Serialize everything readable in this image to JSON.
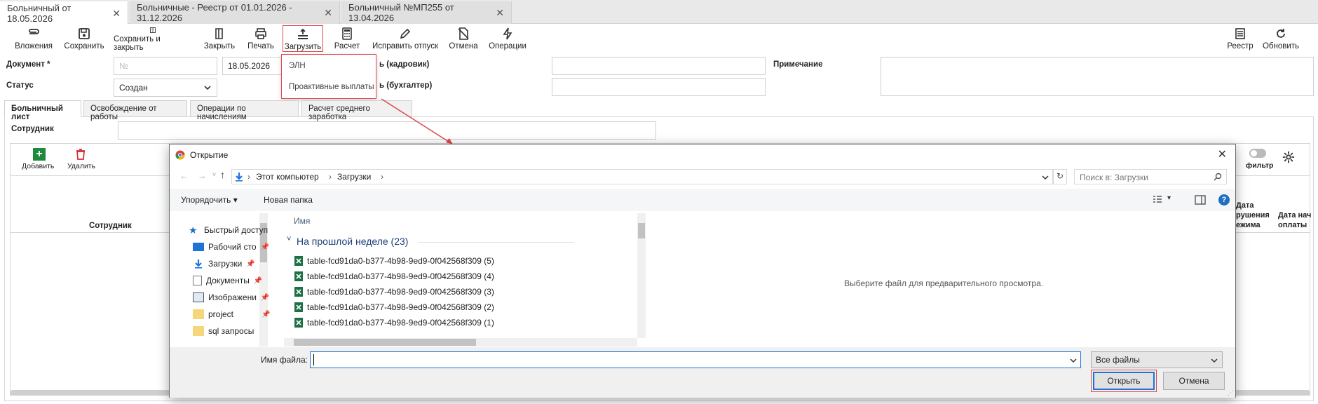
{
  "tabs": [
    {
      "label": "Больничный от 18.05.2026",
      "active": true
    },
    {
      "label": "Больничные - Реестр от 01.01.2026 - 31.12.2026",
      "active": false
    },
    {
      "label": "Больничный №МП255 от 13.04.2026",
      "active": false
    }
  ],
  "toolbar": {
    "attachments": "Вложения",
    "save": "Сохранить",
    "save_close": "Сохранить и закрыть",
    "close": "Закрыть",
    "print": "Печать",
    "load": "Загрузить",
    "calc": "Расчет",
    "fix_leave": "Исправить отпуск",
    "cancel": "Отмена",
    "operations": "Операции",
    "registry": "Реестр",
    "refresh": "Обновить"
  },
  "form": {
    "document_label": "Документ *",
    "number_placeholder": "№",
    "date_value": "18.05.2026",
    "status_label": "Статус",
    "status_value": "Создан",
    "hr_label": "ь (кадровик)",
    "accountant_label": "ь (бухгалтер)",
    "note_label": "Примечание",
    "employee_label": "Сотрудник"
  },
  "load_menu": {
    "items": [
      "ЭЛН",
      "Проактивные выплаты"
    ]
  },
  "subtabs": [
    {
      "label": "Больничный лист",
      "active": true
    },
    {
      "label": "Освобождение от работы",
      "active": false
    },
    {
      "label": "Операции по начислениям",
      "active": false
    },
    {
      "label": "Расчет среднего заработка",
      "active": false
    }
  ],
  "grid": {
    "add": "Добавить",
    "delete": "Удалить",
    "employee_col": "Сотрудник",
    "filter": "фильтр",
    "col_violation": "Дата\nрушения\nежима",
    "col_payment": "Дата нач\nоплаты"
  },
  "dialog": {
    "title": "Открытие",
    "breadcrumb": [
      "Этот компьютер",
      "Загрузки"
    ],
    "search_placeholder": "Поиск в: Загрузки",
    "organize": "Упорядочить",
    "new_folder": "Новая папка",
    "col_name": "Имя",
    "group": "На прошлой неделе (23)",
    "files": [
      "table-fcd91da0-b377-4b98-9ed9-0f042568f309 (5)",
      "table-fcd91da0-b377-4b98-9ed9-0f042568f309 (4)",
      "table-fcd91da0-b377-4b98-9ed9-0f042568f309 (3)",
      "table-fcd91da0-b377-4b98-9ed9-0f042568f309 (2)",
      "table-fcd91da0-b377-4b98-9ed9-0f042568f309 (1)"
    ],
    "nav": [
      {
        "label": "Быстрый доступ",
        "icon": "star-icon"
      },
      {
        "label": "Рабочий сто",
        "icon": "desktop-icon"
      },
      {
        "label": "Загрузки",
        "icon": "download-icon"
      },
      {
        "label": "Документы",
        "icon": "document-icon"
      },
      {
        "label": "Изображени",
        "icon": "image-icon"
      },
      {
        "label": "project",
        "icon": "folder-icon"
      },
      {
        "label": "sql запросы",
        "icon": "folder-icon"
      }
    ],
    "preview_text": "Выберите файл для предварительного просмотра.",
    "filename_label": "Имя файла:",
    "filename_value": "",
    "filter_value": "Все файлы",
    "open": "Открыть",
    "cancel": "Отмена"
  },
  "colors": {
    "accent_red": "#e0474c",
    "link_blue": "#1f5fa8",
    "excel_green": "#1d7044"
  }
}
